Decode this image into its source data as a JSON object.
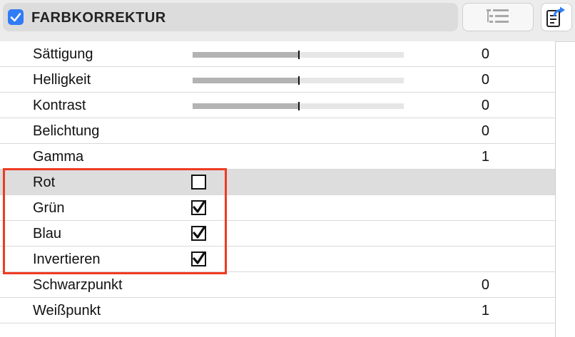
{
  "section": {
    "title": "FARBKORREKTUR",
    "enabled": true,
    "check_icon": "checkmark-icon",
    "accent_color": "#2f7cf6"
  },
  "toolbar": {
    "list_icon": "tree-list-icon",
    "preset_icon": "document-arrow-icon"
  },
  "rows": [
    {
      "label": "Sättigung",
      "value": "0",
      "slider_level": 0.5
    },
    {
      "label": "Helligkeit",
      "value": "0",
      "slider_level": 0.5
    },
    {
      "label": "Kontrast",
      "value": "0",
      "slider_level": 0.5
    },
    {
      "label": "Belichtung",
      "value": "0"
    },
    {
      "label": "Gamma",
      "value": "1"
    },
    {
      "label": "Rot",
      "checked": false,
      "selected": true
    },
    {
      "label": "Grün",
      "checked": true
    },
    {
      "label": "Blau",
      "checked": true
    },
    {
      "label": "Invertieren",
      "checked": true
    },
    {
      "label": "Schwarzpunkt",
      "value": "0"
    },
    {
      "label": "Weißpunkt",
      "value": "1"
    }
  ],
  "annotation": {
    "color": "#ee3a22"
  }
}
